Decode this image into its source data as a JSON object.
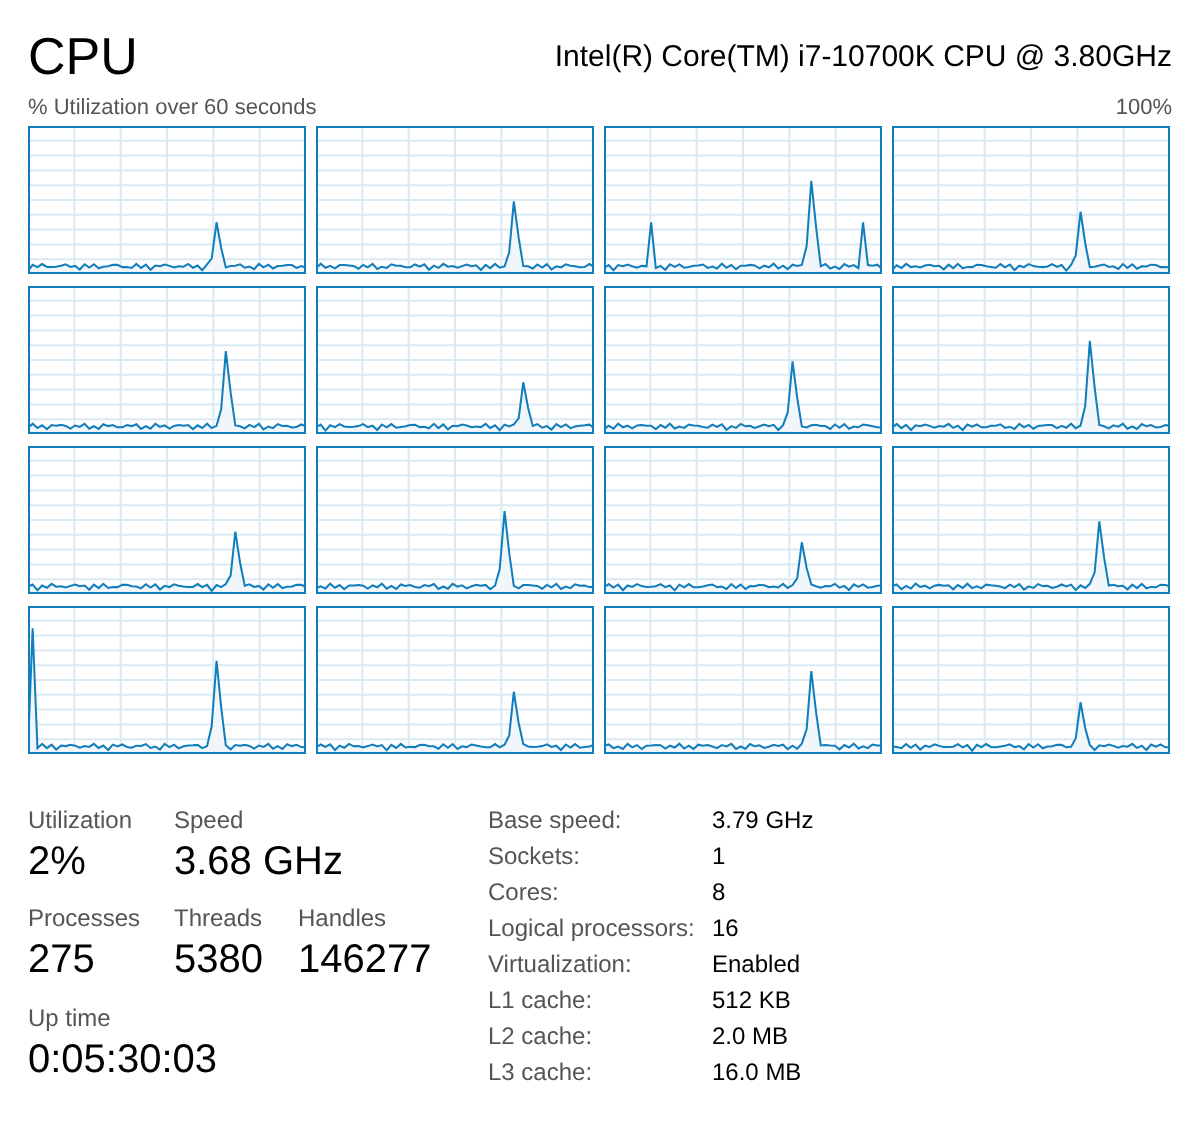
{
  "header": {
    "title": "CPU",
    "processor": "Intel(R) Core(TM) i7-10700K CPU @ 3.80GHz"
  },
  "graph_panel": {
    "caption": "% Utilization over 60 seconds",
    "max_label": "100%",
    "graphs": [
      {
        "kind": "sparkline"
      },
      {
        "kind": "sparkline"
      },
      {
        "kind": "sparkline"
      },
      {
        "kind": "sparkline"
      },
      {
        "kind": "sparkline"
      },
      {
        "kind": "sparkline"
      },
      {
        "kind": "sparkline"
      },
      {
        "kind": "sparkline"
      },
      {
        "kind": "sparkline"
      },
      {
        "kind": "sparkline"
      },
      {
        "kind": "sparkline"
      },
      {
        "kind": "sparkline"
      },
      {
        "kind": "sparkline"
      },
      {
        "kind": "sparkline"
      },
      {
        "kind": "sparkline"
      },
      {
        "kind": "sparkline"
      }
    ]
  },
  "stats": [
    {
      "label": "Utilization",
      "value": "2%"
    },
    {
      "label": "Speed",
      "value": "3.68 GHz"
    },
    {
      "label": "Processes",
      "value": "275"
    },
    {
      "label": "Threads",
      "value": "5380"
    },
    {
      "label": "Handles",
      "value": "146277"
    },
    {
      "label": "Up time",
      "value": "0:05:30:03"
    }
  ],
  "details": [
    {
      "label": "Base speed:",
      "value": "3.79 GHz"
    },
    {
      "label": "Sockets:",
      "value": "1"
    },
    {
      "label": "Cores:",
      "value": "8"
    },
    {
      "label": "Logical processors:",
      "value": "16"
    },
    {
      "label": "Virtualization:",
      "value": "Enabled"
    },
    {
      "label": "L1 cache:",
      "value": "512 KB"
    },
    {
      "label": "L2 cache:",
      "value": "2.0 MB"
    },
    {
      "label": "L3 cache:",
      "value": "16.0 MB"
    }
  ]
}
